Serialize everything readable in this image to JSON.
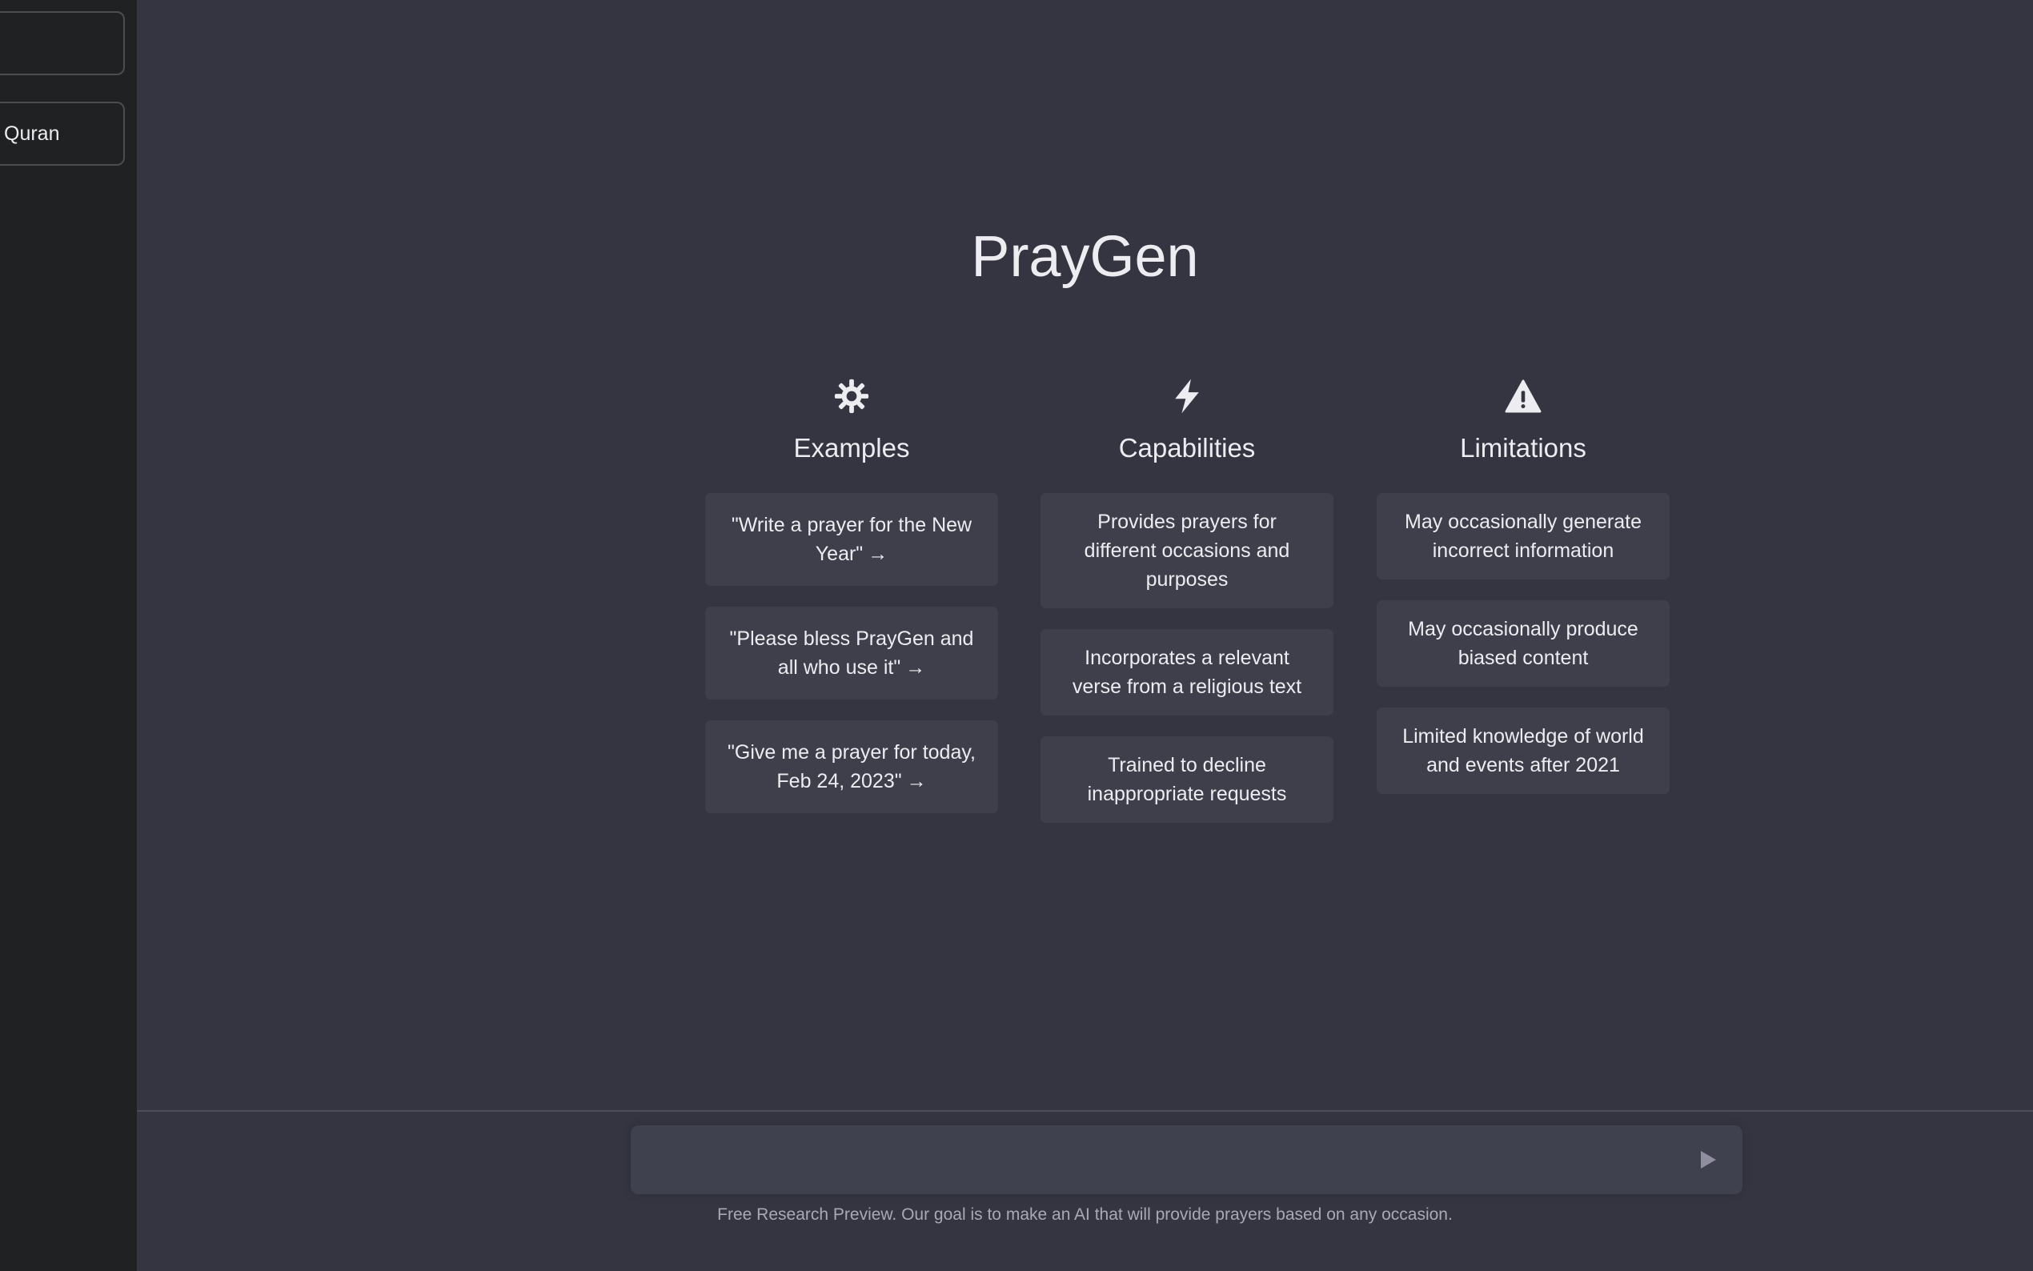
{
  "sidebar": {
    "items": [
      {
        "label": ""
      },
      {
        "label": "Quran"
      }
    ]
  },
  "main": {
    "title": "PrayGen",
    "columns": [
      {
        "title": "Examples",
        "icon": "sun-icon",
        "cards": [
          "\"Write a prayer for the New Year\"",
          "\"Please bless PrayGen and all who use it\"",
          "\"Give me a prayer for today, Feb 24, 2023\""
        ]
      },
      {
        "title": "Capabilities",
        "icon": "lightning-icon",
        "cards": [
          "Provides prayers for different occasions and purposes",
          "Incorporates a relevant verse from a religious text",
          "Trained to decline inappropriate requests"
        ]
      },
      {
        "title": "Limitations",
        "icon": "warning-icon",
        "cards": [
          "May occasionally generate incorrect information",
          "May occasionally produce biased content",
          "Limited knowledge of world and events after 2021"
        ]
      }
    ]
  },
  "input": {
    "value": "",
    "placeholder": ""
  },
  "footer": {
    "note": "Free Research Preview. Our goal is to make an AI that will provide prayers based on any occasion."
  },
  "colors": {
    "main_bg": "#343541",
    "sidebar_bg": "#202123",
    "card_bg": "#3e3f4b",
    "input_bg": "#40414f",
    "text": "#ececf1"
  }
}
